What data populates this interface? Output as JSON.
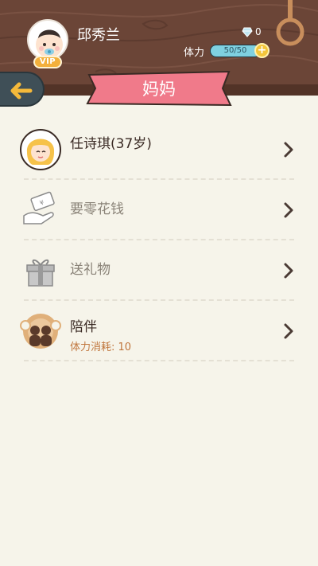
{
  "header": {
    "username": "邱秀兰",
    "vip_label": "VIP",
    "diamond_count": "0",
    "energy_label": "体力",
    "energy_text": "50/50",
    "energy_fraction": 1.0,
    "plus_symbol": "+"
  },
  "page": {
    "title": "妈妈"
  },
  "items": [
    {
      "label": "任诗琪(37岁)",
      "icon": "girl-avatar-icon"
    },
    {
      "label": "要零花钱",
      "icon": "money-hand-icon"
    },
    {
      "label": "送礼物",
      "icon": "gift-icon"
    },
    {
      "label": "陪伴",
      "sub": "体力消耗: 10",
      "icon": "companion-icon"
    }
  ],
  "colors": {
    "wood": "#6b4537",
    "ribbon": "#f07a8a",
    "background": "#f6f4ea",
    "energy_fill": "#7fd0e0",
    "accent_text": "#c0763d"
  }
}
